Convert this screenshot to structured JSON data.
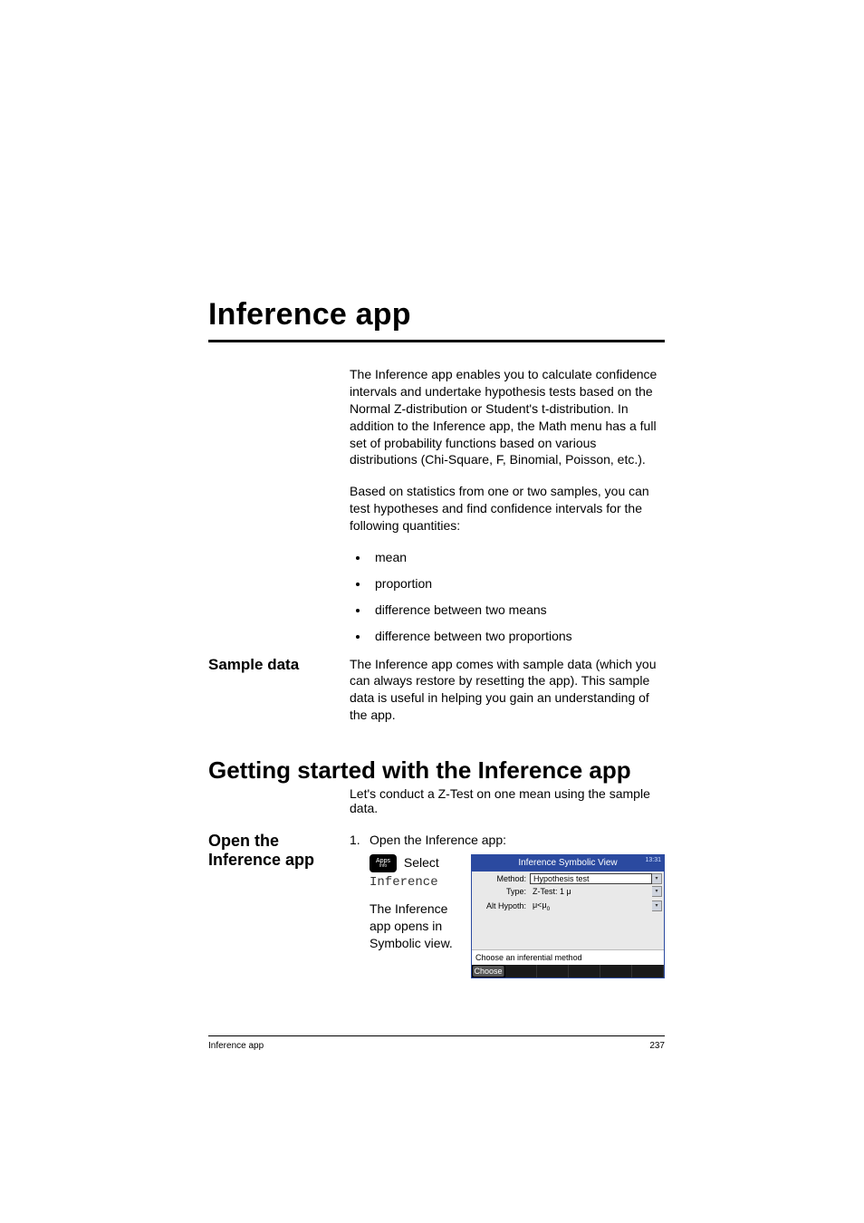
{
  "chapter_title": "Inference app",
  "intro_para_1": "The Inference app enables you to calculate confidence intervals and undertake hypothesis tests based on the Normal Z-distribution or Student's t-distribution. In addition to the Inference app, the Math menu has a full set of probability functions based on various distributions (Chi-Square, F, Binomial, Poisson, etc.).",
  "intro_para_2": "Based on statistics from one or two samples, you can test hypotheses and find confidence intervals for the following quantities:",
  "bullets": [
    "mean",
    "proportion",
    "difference between two means",
    "difference between two proportions"
  ],
  "sample": {
    "heading": "Sample data",
    "text": "The Inference app comes with sample data (which you can always restore by resetting the app). This sample data is useful in helping you gain an understanding of the app."
  },
  "section2": {
    "heading": "Getting started with the Inference app",
    "subtitle": "Let's conduct a Z-Test on one mean using the sample data."
  },
  "step": {
    "side_heading": "Open the Inference app",
    "number": "1.",
    "line1": "Open the Inference app:",
    "apps_key_top": "Apps",
    "apps_key_bottom": "Info",
    "select_word": "Select",
    "mono_word": "Inference",
    "after_text": "The Inference app opens in Symbolic view."
  },
  "calc": {
    "title": "Inference Symbolic View",
    "clock": "13:31",
    "rows": {
      "method_label": "Method:",
      "method_value": "Hypothesis test",
      "type_label": "Type:",
      "type_value": "Z-Test: 1 μ",
      "alt_label": "Alt Hypoth:",
      "alt_value_html": "μ<μ₀"
    },
    "help_text": "Choose an inferential method",
    "softkeys": [
      "Choose",
      "",
      "",
      "",
      "",
      ""
    ]
  },
  "footer": {
    "left": "Inference app",
    "right": "237"
  }
}
